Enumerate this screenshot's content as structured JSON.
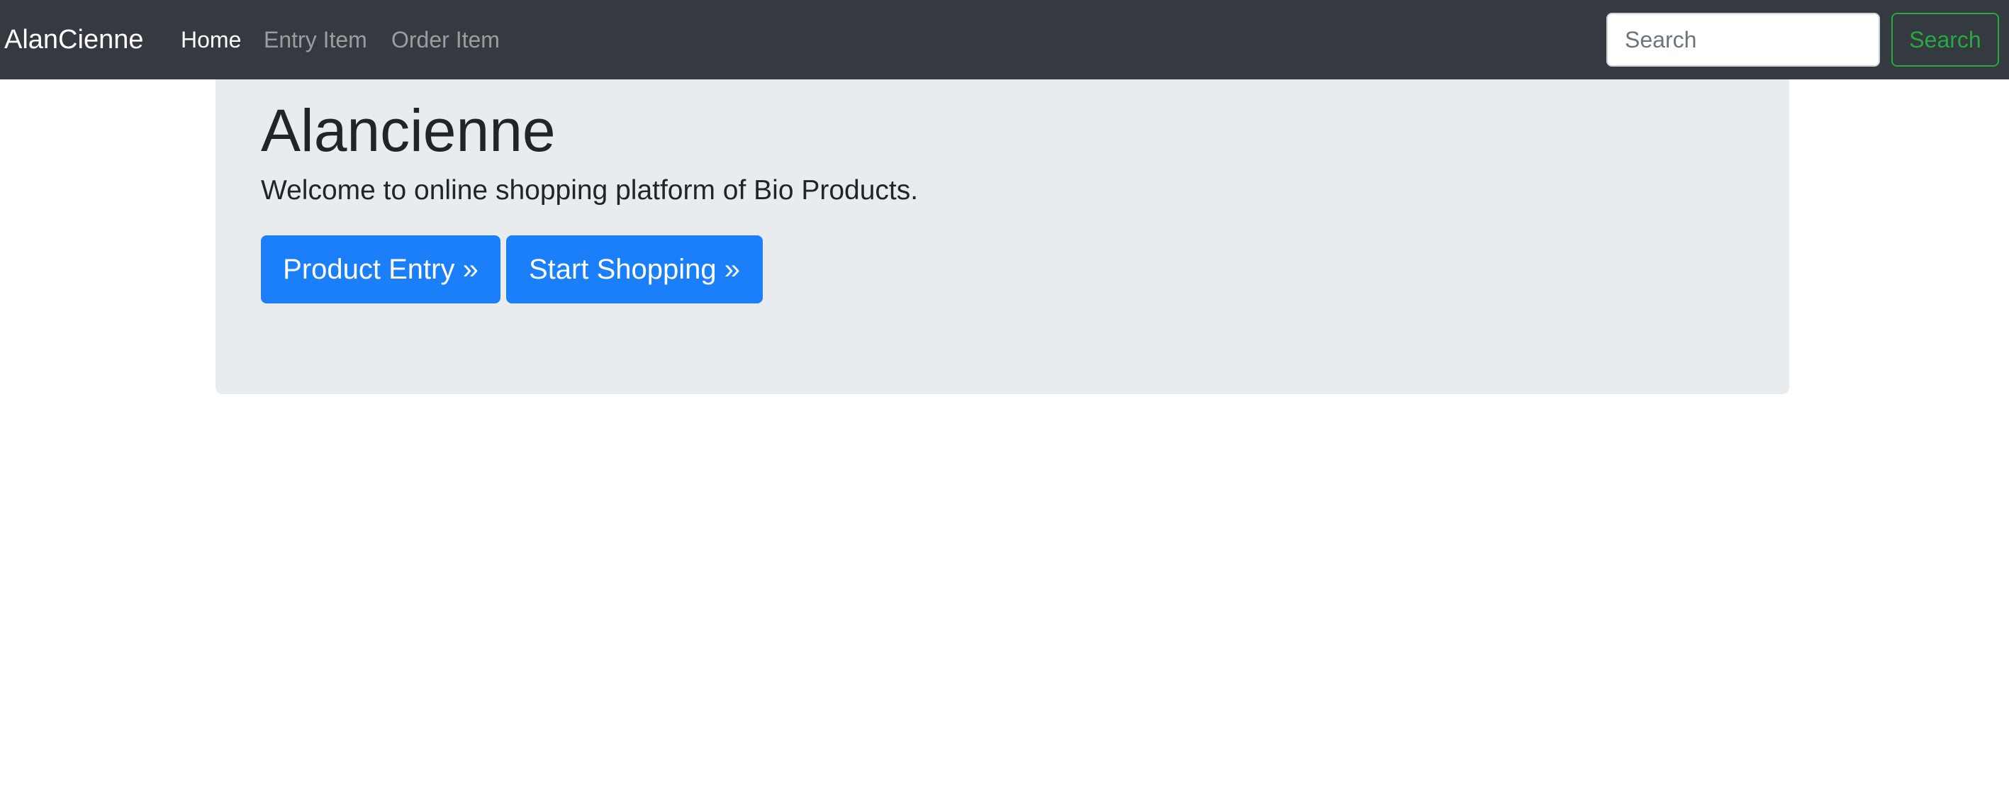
{
  "navbar": {
    "brand": "AlanCienne",
    "links": [
      {
        "label": "Home",
        "active": true
      },
      {
        "label": "Entry Item",
        "active": false
      },
      {
        "label": "Order Item",
        "active": false
      }
    ],
    "search": {
      "placeholder": "Search",
      "value": "",
      "button_label": "Search"
    }
  },
  "jumbotron": {
    "title": "Alancienne",
    "lead": "Welcome to online shopping platform of Bio Products.",
    "buttons": [
      {
        "label": "Product Entry »"
      },
      {
        "label": "Start Shopping »"
      }
    ]
  },
  "colors": {
    "navbar_bg": "#343a40",
    "jumbotron_bg": "#e9ecef",
    "primary": "#1a7ff8",
    "success": "#28a745"
  }
}
